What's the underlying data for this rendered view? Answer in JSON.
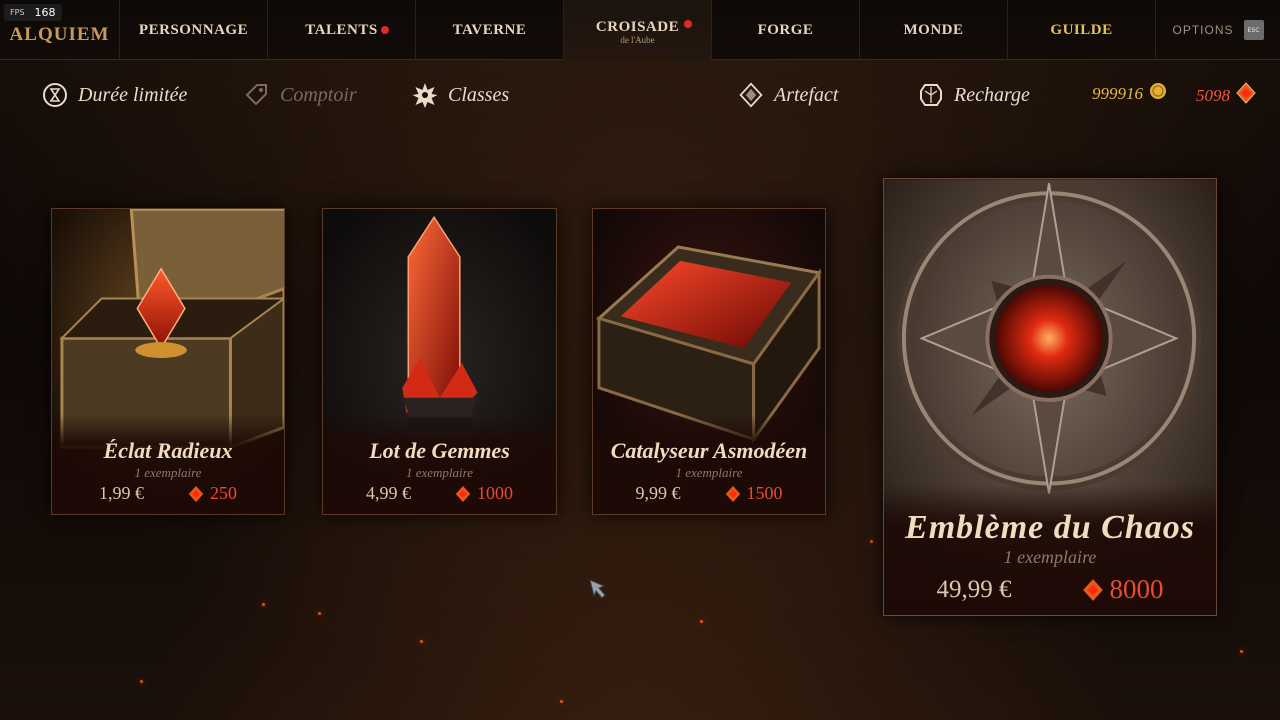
{
  "fps": {
    "label": "FPS",
    "value": "168"
  },
  "logo": "ALQUIEM",
  "nav": [
    {
      "label": "PERSONNAGE",
      "icon": "character-icon"
    },
    {
      "label": "TALENTS",
      "icon": "talents-icon",
      "notify": true
    },
    {
      "label": "TAVERNE",
      "icon": "tavern-icon"
    },
    {
      "label": "CROISADE",
      "sub": "de l'Aube",
      "icon": "crusade-icon",
      "notify": true,
      "selected": true
    },
    {
      "label": "FORGE",
      "icon": "forge-icon"
    },
    {
      "label": "MONDE",
      "icon": "world-icon"
    },
    {
      "label": "GUILDE",
      "icon": "guild-icon",
      "highlight": "#e8c25a"
    }
  ],
  "options": {
    "label": "OPTIONS",
    "key": "ESC"
  },
  "tabs": {
    "limited": "Durée limitée",
    "counter": "Comptoir",
    "classes": "Classes",
    "artifact": "Artefact",
    "recharge": "Recharge"
  },
  "currency": {
    "gold": "999916",
    "gems": "5098"
  },
  "products": [
    {
      "title": "Éclat Radieux",
      "qty": "1 exemplaire",
      "price": "1,99 €",
      "gems": "250"
    },
    {
      "title": "Lot de Gemmes",
      "qty": "1 exemplaire",
      "price": "4,99 €",
      "gems": "1000"
    },
    {
      "title": "Catalyseur Asmodéen",
      "qty": "1 exemplaire",
      "price": "9,99 €",
      "gems": "1500"
    },
    {
      "title": "Emblème du Chaos",
      "qty": "1 exemplaire",
      "price": "49,99 €",
      "gems": "8000"
    }
  ],
  "colors": {
    "accent": "#e84b35",
    "gold": "#e8c25a",
    "notify": "#e02a2a"
  }
}
